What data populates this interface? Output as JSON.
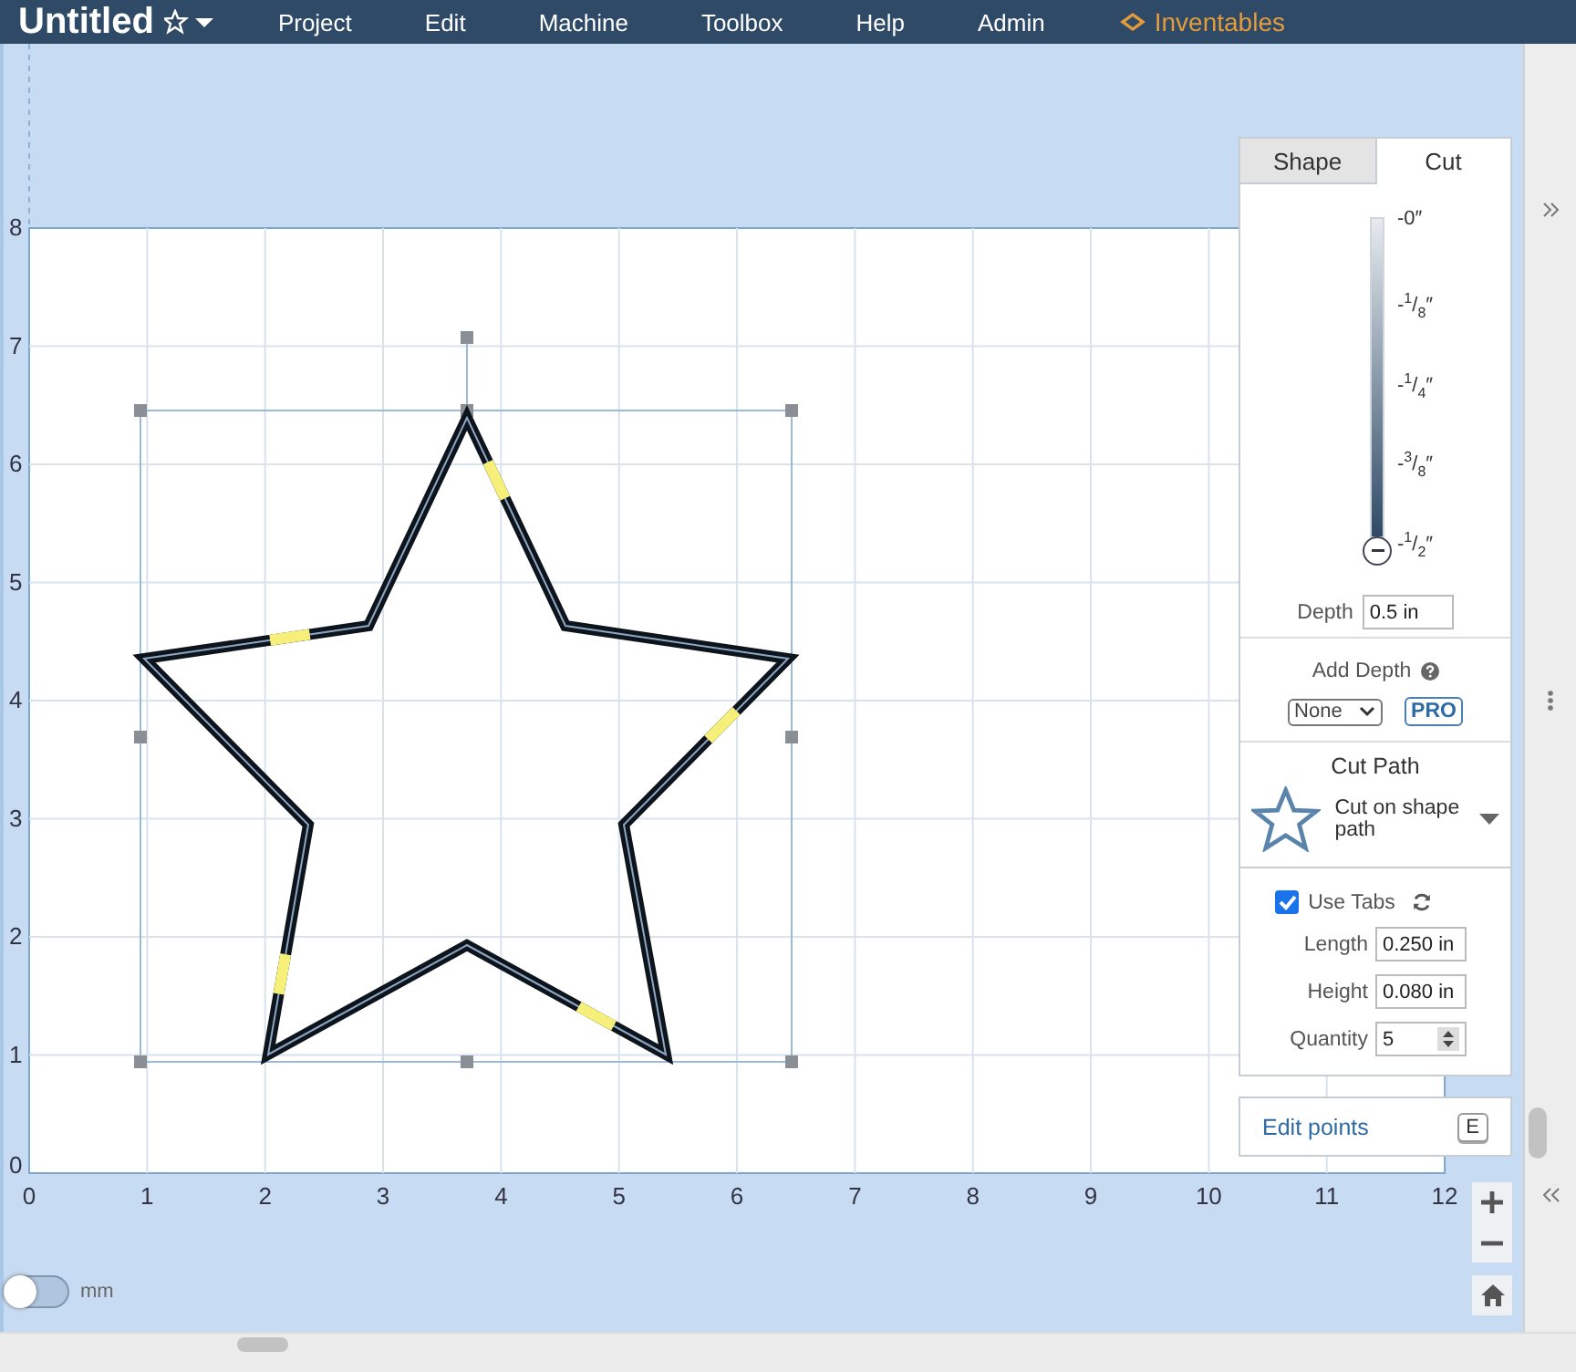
{
  "header": {
    "title": "Untitled",
    "menu": [
      "Project",
      "Edit",
      "Machine",
      "Toolbox",
      "Help",
      "Admin"
    ],
    "brand": "Inventables"
  },
  "canvas": {
    "x_labels": [
      "0",
      "1",
      "2",
      "3",
      "4",
      "5",
      "6",
      "7",
      "8",
      "9",
      "10",
      "11",
      "12"
    ],
    "y_labels": [
      "8",
      "7",
      "6",
      "5",
      "4",
      "3",
      "2",
      "1",
      "0"
    ]
  },
  "panel": {
    "tabs": [
      {
        "label": "Shape",
        "selected": false
      },
      {
        "label": "Cut",
        "selected": true
      }
    ],
    "depth_scale": {
      "marks": [
        "-0″",
        "-$^{1}$/$_{8}$″",
        "-$^{1}$/$_{4}$″",
        "-$^{3}$/$_{8}$″",
        "-$^{1}$/$_{2}$″"
      ],
      "level": 1
    },
    "depth": {
      "label": "Depth",
      "value": "0.5 in"
    },
    "add_depth": {
      "label": "Add Depth",
      "select": "None",
      "badge": "PRO"
    },
    "cut_path": {
      "title": "Cut Path",
      "option": "Cut on shape path"
    },
    "use_tabs": {
      "label": "Use Tabs",
      "checked": true
    },
    "fields": [
      {
        "label": "Length",
        "value": "0.250 in"
      },
      {
        "label": "Height",
        "value": "0.080 in"
      },
      {
        "label": "Quantity",
        "value": "5"
      }
    ],
    "edit_points": {
      "label": "Edit points",
      "key": "E"
    }
  },
  "units_toggle": {
    "label": "mm",
    "on": false
  }
}
